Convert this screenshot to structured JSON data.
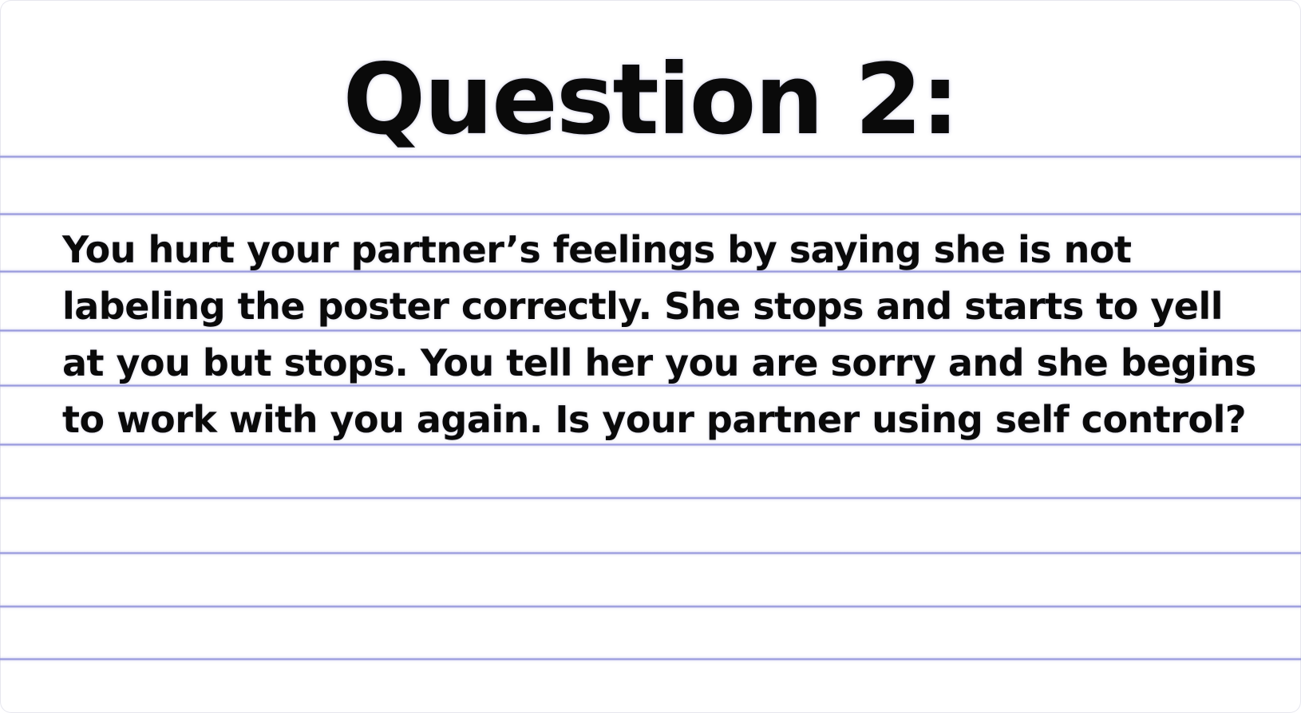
{
  "card": {
    "title": "Question 2:",
    "question_lines": [
      "You hurt your partner’s feelings by saying she is not",
      "labeling the poster correctly. She stops and starts to yell",
      "at you but stops. You tell her you are sorry and she begins",
      "to work with you again. Is your partner using self control?"
    ],
    "line_color": "#8d8fd8",
    "text_color": "#0a0a0a"
  }
}
